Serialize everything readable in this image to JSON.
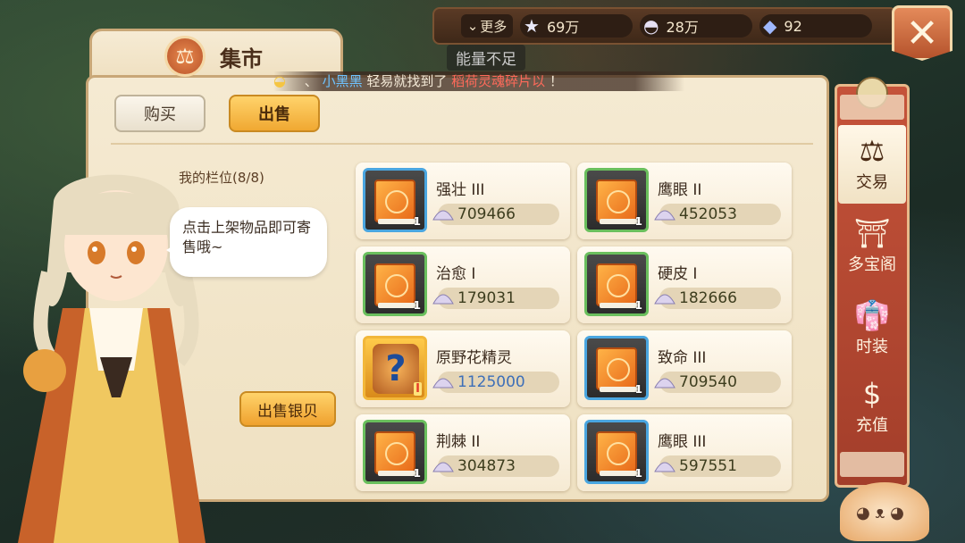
{
  "topbar": {
    "more_label": "更多",
    "stars": "69万",
    "shells": "28万",
    "gems": "92"
  },
  "toast": "能量不足",
  "header": {
    "title": "集市"
  },
  "marquee": {
    "prefix": "、",
    "player": "小黑黑",
    "text": "轻易就找到了",
    "item": "稻荷灵魂碎片以",
    "suffix": "！"
  },
  "tabs": {
    "buy": "购买",
    "sell": "出售"
  },
  "slots_title": "我的栏位(8/8)",
  "bubble": "点击上架物品即可寄售哦~",
  "sell_silver": "出售银贝",
  "items": [
    {
      "name": "强壮 III",
      "price": "709466",
      "qty": "1",
      "frame": "blue"
    },
    {
      "name": "鹰眼 II",
      "price": "452053",
      "qty": "1",
      "frame": "green"
    },
    {
      "name": "治愈 I",
      "price": "179031",
      "qty": "1",
      "frame": "green"
    },
    {
      "name": "硬皮 I",
      "price": "182666",
      "qty": "1",
      "frame": "green"
    },
    {
      "name": "原野花精灵",
      "price": "1125000",
      "qty": "I",
      "frame": "gold"
    },
    {
      "name": "致命 III",
      "price": "709540",
      "qty": "1",
      "frame": "blue"
    },
    {
      "name": "荆棘 II",
      "price": "304873",
      "qty": "1",
      "frame": "green"
    },
    {
      "name": "鹰眼 III",
      "price": "597551",
      "qty": "1",
      "frame": "blue"
    }
  ],
  "side_menu": [
    {
      "label": "交易",
      "icon": "scale-icon"
    },
    {
      "label": "多宝阁",
      "icon": "treasure-icon"
    },
    {
      "label": "时装",
      "icon": "clothing-icon"
    },
    {
      "label": "充值",
      "icon": "dollar-icon"
    }
  ],
  "colors": {
    "accent": "#f0a832",
    "panel": "#f5ead2",
    "side": "#b5472f"
  }
}
